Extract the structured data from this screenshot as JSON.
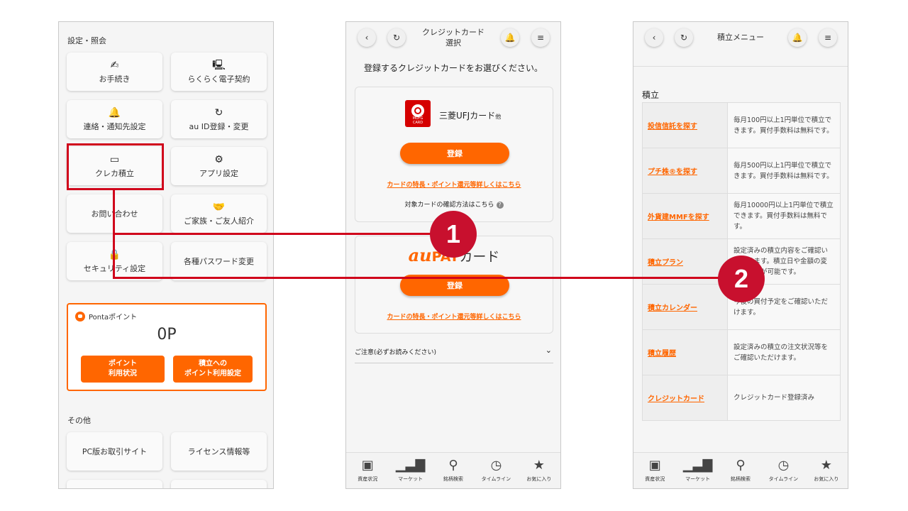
{
  "phone1": {
    "section1_title": "設定・照会",
    "tiles": [
      {
        "label": "お手続き",
        "icon": "✍"
      },
      {
        "label": "らくらく電子契約",
        "icon": "🖳"
      },
      {
        "label": "連絡・通知先設定",
        "icon": "🔔"
      },
      {
        "label": "au ID登録・変更",
        "icon": "↻"
      },
      {
        "label": "クレカ積立",
        "icon": "▭"
      },
      {
        "label": "アプリ設定",
        "icon": "⚙"
      },
      {
        "label": "お問い合わせ",
        "icon": ""
      },
      {
        "label": "ご家族・ご友人紹介",
        "icon": "🤝"
      },
      {
        "label": "セキュリティ設定",
        "icon": "🔒"
      },
      {
        "label": "各種パスワード変更",
        "icon": ""
      }
    ],
    "ponta": {
      "title": "Pontaポイント",
      "points": "0P",
      "btn1": "ポイント\n利用状況",
      "btn2": "積立への\nポイント利用設定"
    },
    "section2_title": "その他",
    "others": [
      {
        "label": "PC版お取引サイト"
      },
      {
        "label": "ライセンス情報等"
      }
    ]
  },
  "phone2": {
    "header_title": "クレジットカード\n選択",
    "lead": "登録するクレジットカードをお選びください。",
    "mufg": {
      "logo_text": "MUFG\nCARD",
      "name": "三菱UFJカード",
      "name_suffix": "他",
      "register": "登録",
      "link": "カードの特長・ポイント還元等詳しくはこちら",
      "confirm": "対象カードの確認方法はこちら",
      "help_icon": "?"
    },
    "aupay": {
      "au": "au",
      "pay": "PAY",
      "kd": "カード",
      "register": "登録",
      "link": "カードの特長・ポイント還元等詳しくはこちら"
    },
    "notice": "ご注意(必ずお読みください)"
  },
  "phone3": {
    "header_title": "積立メニュー",
    "section": "積立",
    "rows": [
      {
        "link": "投信信託を探す",
        "desc": "毎月100円以上1円単位で積立できます。買付手数料は無料です。"
      },
      {
        "link": "プチ株®を探す",
        "desc": "毎月500円以上1円単位で積立できます。買付手数料は無料です。"
      },
      {
        "link": "外貨建MMFを探す",
        "desc": "毎月10000円以上1円単位で積立できます。買付手数料は無料です。"
      },
      {
        "link": "積立プラン",
        "desc": "設定済みの積立内容をご確認いただけます。積立日や金額の変更、中止が可能です。"
      },
      {
        "link": "積立カレンダー",
        "desc": "今後の買付予定をご確認いただけます。"
      },
      {
        "link": "積立履歴",
        "desc": "設定済みの積立の注文状況等をご確認いただけます。"
      },
      {
        "link": "クレジットカード",
        "desc": "クレジットカード登録済み"
      }
    ]
  },
  "nav": [
    {
      "label": "資産状況",
      "icon": "wallet-icon"
    },
    {
      "label": "マーケット",
      "icon": "bar-chart-icon"
    },
    {
      "label": "銘柄検索",
      "icon": "search-icon"
    },
    {
      "label": "タイムライン",
      "icon": "clock-icon"
    },
    {
      "label": "お気に入り",
      "icon": "star-icon"
    }
  ],
  "header_icons": {
    "back": "‹",
    "reload": "↻",
    "bell": "🔔",
    "menu": "≡"
  },
  "badges": {
    "one": "1",
    "two": "2"
  },
  "colors": {
    "accent": "#ff6600",
    "highlight": "#d0021b",
    "badge": "#c8102e"
  }
}
